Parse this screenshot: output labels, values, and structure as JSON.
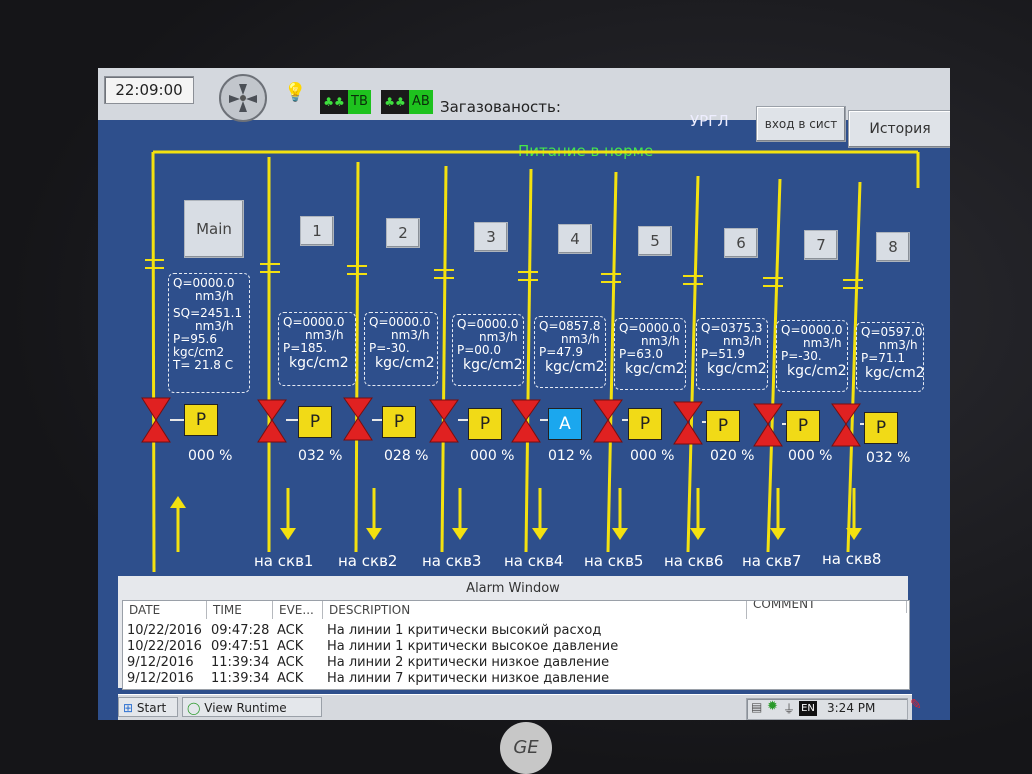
{
  "header": {
    "clock": "22:09:00",
    "mode_tv": "ТВ",
    "mode_av": "АВ",
    "gas_label": "Загазованость:",
    "site": "УРГЛ",
    "login_button": "вход в сист",
    "history_button": "История"
  },
  "status": "Питание в норме",
  "main": {
    "button": "Main",
    "q": "Q=0000.0",
    "q_unit": "nm3/h",
    "sq": "SQ=2451.1",
    "sq_unit": "nm3/h",
    "p": "P=95.6",
    "p_unit": "kgc/cm2",
    "t": "T= 21.8 C",
    "mode": "P",
    "percent": "000 %"
  },
  "wells": [
    {
      "id": "1",
      "q": "Q=0000.0",
      "q_unit": "nm3/h",
      "p": "P=185.",
      "p_unit": "kgc/cm2",
      "mode": "P",
      "percent": "032 %",
      "dest": "на скв1"
    },
    {
      "id": "2",
      "q": "Q=0000.0",
      "q_unit": "nm3/h",
      "p": "P=-30.",
      "p_unit": "kgc/cm2",
      "mode": "P",
      "percent": "028 %",
      "dest": "на скв2"
    },
    {
      "id": "3",
      "q": "Q=0000.0",
      "q_unit": "nm3/h",
      "p": "P=00.0",
      "p_unit": "kgc/cm2",
      "mode": "P",
      "percent": "000 %",
      "dest": "на скв3"
    },
    {
      "id": "4",
      "q": "Q=0857.8",
      "q_unit": "nm3/h",
      "p": "P=47.9",
      "p_unit": "kgc/cm2",
      "mode": "A",
      "percent": "012 %",
      "dest": "на скв4"
    },
    {
      "id": "5",
      "q": "Q=0000.0",
      "q_unit": "nm3/h",
      "p": "P=63.0",
      "p_unit": "kgc/cm2",
      "mode": "P",
      "percent": "000 %",
      "dest": "на скв5"
    },
    {
      "id": "6",
      "q": "Q=0375.3",
      "q_unit": "nm3/h",
      "p": "P=51.9",
      "p_unit": "kgc/cm2",
      "mode": "P",
      "percent": "020 %",
      "dest": "на скв6"
    },
    {
      "id": "7",
      "q": "Q=0000.0",
      "q_unit": "nm3/h",
      "p": "P=-30.",
      "p_unit": "kgc/cm2",
      "mode": "P",
      "percent": "000 %",
      "dest": "на скв7"
    },
    {
      "id": "8",
      "q": "Q=0597.0",
      "q_unit": "nm3/h",
      "p": "P=71.1",
      "p_unit": "kgc/cm2",
      "mode": "P",
      "percent": "032 %",
      "dest": "на скв8"
    }
  ],
  "alarm": {
    "title": "Alarm Window",
    "columns": [
      "DATE",
      "TIME",
      "EVE...",
      "DESCRIPTION",
      "COMMENT"
    ],
    "rows": [
      {
        "date": "10/22/2016",
        "time": "09:47:28",
        "event": "ACK",
        "description": "На линии 1 критически высокий расход"
      },
      {
        "date": "10/22/2016",
        "time": "09:47:51",
        "event": "ACK",
        "description": "На линии 1 критически высокое давление"
      },
      {
        "date": "9/12/2016",
        "time": "11:39:34",
        "event": "ACK",
        "description": "На линии 2 критически низкое давление"
      },
      {
        "date": "9/12/2016",
        "time": "11:39:34",
        "event": "ACK",
        "description": "На линии 7 критически низкое давление"
      }
    ]
  },
  "taskbar": {
    "start": "Start",
    "app": "View Runtime",
    "lang": "EN",
    "time": "3:24 PM"
  },
  "brand": "GE",
  "colors": {
    "background": "#2e4f8c",
    "pipe": "#f3e10f",
    "valve": "#e02121",
    "status_ok": "#45e84a",
    "mode_p": "#f1da17",
    "mode_a": "#1ba7ee"
  }
}
